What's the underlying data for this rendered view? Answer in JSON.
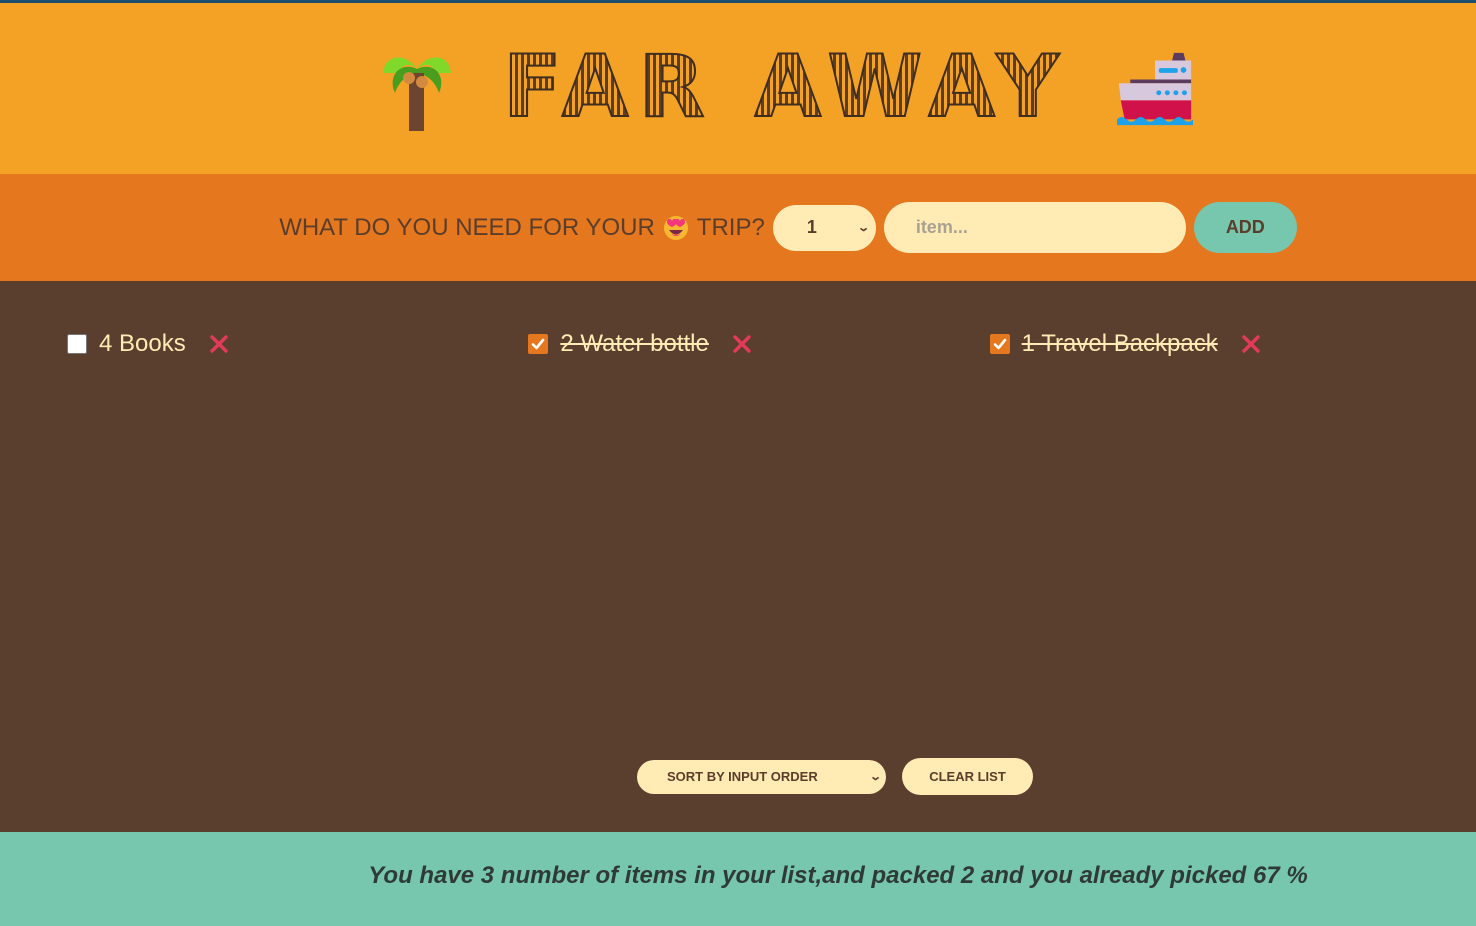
{
  "header": {
    "title": "FAR AWAY",
    "left_icon": "palm-tree-icon",
    "right_icon": "ship-icon"
  },
  "form": {
    "question_prefix": "WHAT DO YOU NEED FOR YOUR",
    "question_emoji": "heart-eyes-icon",
    "question_suffix": "TRIP?",
    "quantity_selected": "1",
    "item_placeholder": "item...",
    "item_value": "",
    "add_label": "ADD"
  },
  "items": [
    {
      "quantity": 4,
      "description": "Books",
      "label": "4 Books",
      "packed": false
    },
    {
      "quantity": 2,
      "description": "Water bottle",
      "label": "2 Water bottle",
      "packed": true
    },
    {
      "quantity": 1,
      "description": "Travel Backpack",
      "label": "1 Travel Backpack",
      "packed": true
    }
  ],
  "actions": {
    "sort_selected": "SORT BY INPUT ORDER",
    "clear_label": "CLEAR LIST"
  },
  "stats": {
    "text": "You have 3 number of items in your list,and packed 2 and you already picked 67 %",
    "total_items": 3,
    "packed_items": 2,
    "percent_packed": 67
  },
  "colors": {
    "header_bg": "#f4a226",
    "form_bg": "#e5771e",
    "list_bg": "#5a3e2e",
    "stats_bg": "#76c7ad",
    "pill_bg": "#ffebb3",
    "accent_text": "#5a3e2b",
    "delete_red": "#e33a5a"
  }
}
